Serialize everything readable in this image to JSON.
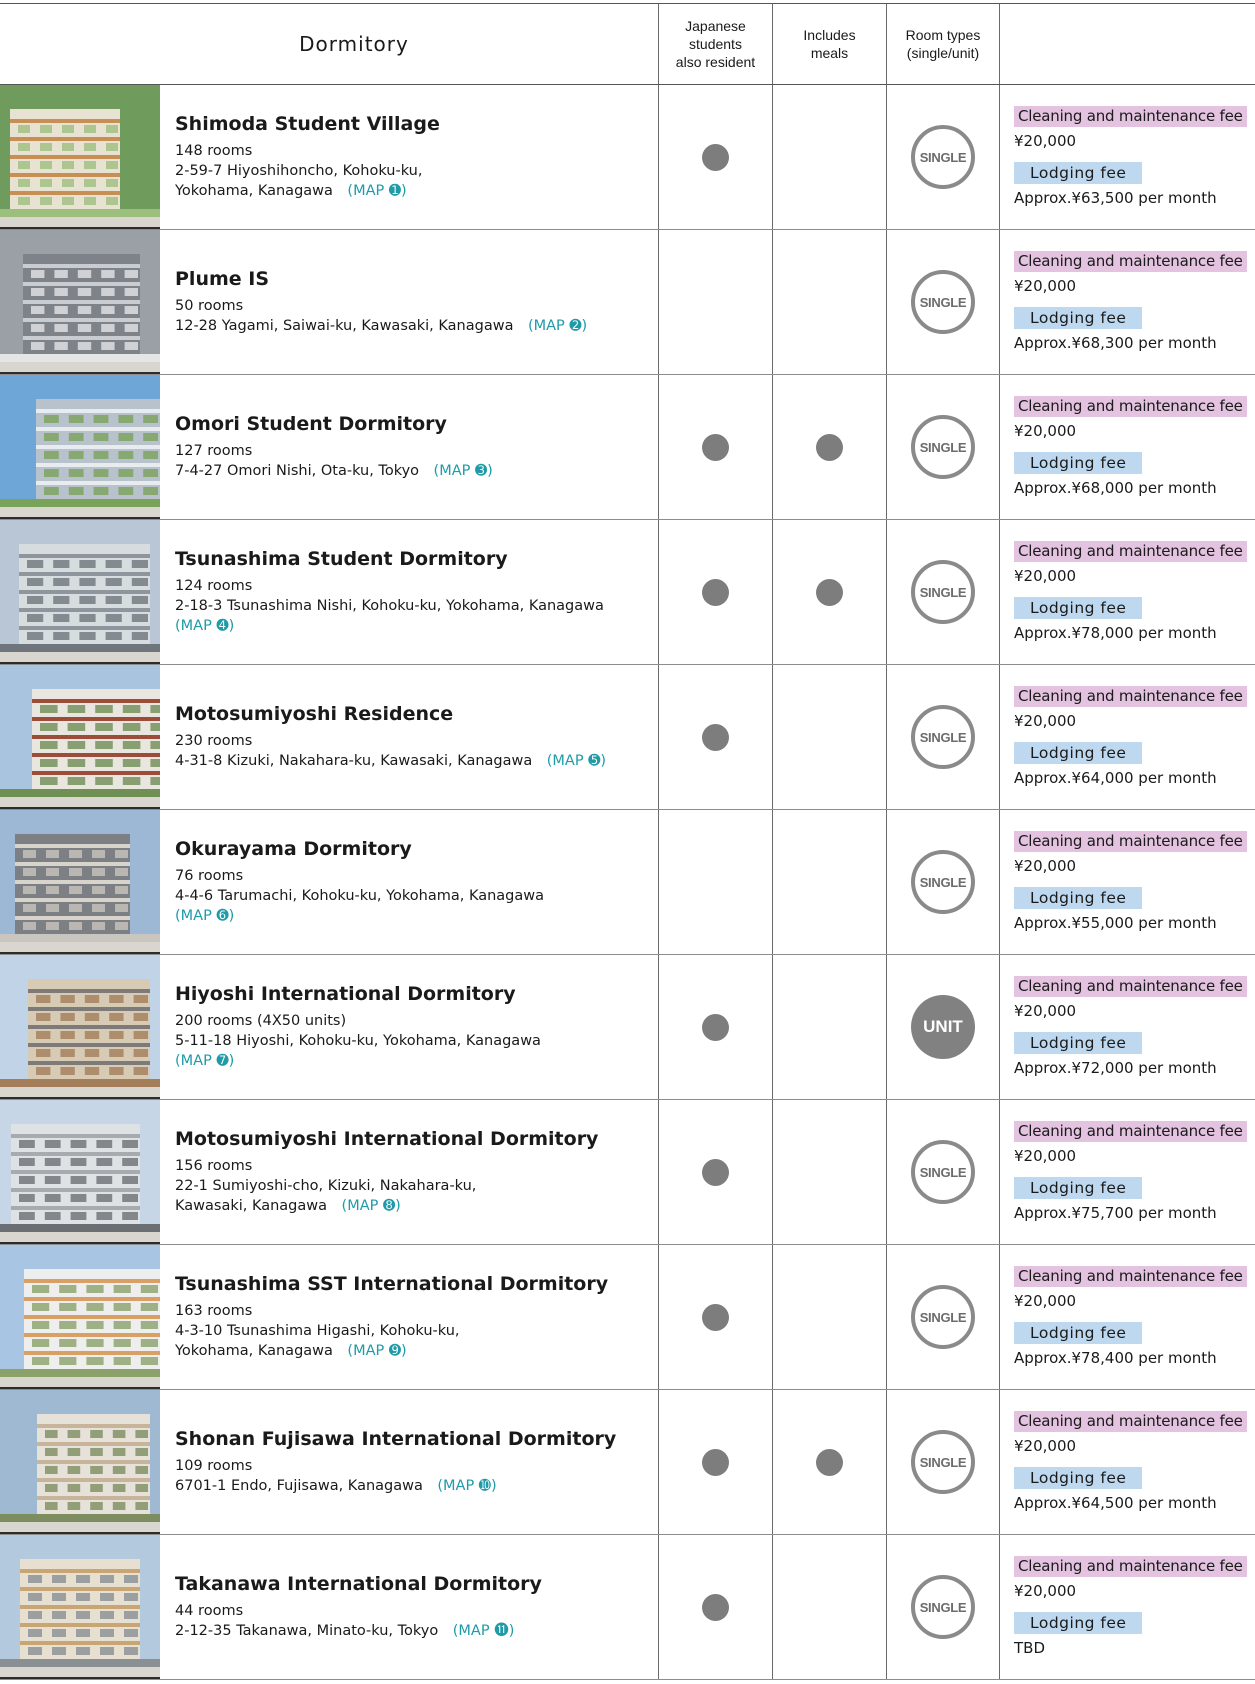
{
  "header": {
    "dormitory": "Dormitory",
    "japanese": "Japanese\nstudents\nalso resident",
    "meals": "Includes\nmeals",
    "room_types": "Room types\n(single/unit)"
  },
  "labels": {
    "cleaning_fee": "Cleaning and maintenance fee",
    "lodging_fee": "Lodging fee",
    "single": "SINGLE",
    "unit": "UNIT"
  },
  "colors": {
    "cleaning_tag": "#e3c3e0",
    "lodging_tag": "#bed8f0",
    "map_link": "#1f9ba8",
    "mark": "#7d7d7d"
  },
  "dorms": [
    {
      "name": "Shimoda Student Village",
      "rooms": "148 rooms",
      "address": "2-59-7 Hiyoshihoncho, Kohoku-ku,\nYokohama, Kanagawa　",
      "map": "(MAP ➊)",
      "japanese": true,
      "meals": false,
      "room_type": "single",
      "cleaning": "¥20,000",
      "lodging": "Approx.¥63,500 per month"
    },
    {
      "name": "Plume IS",
      "rooms": "50 rooms",
      "address": "12-28 Yagami, Saiwai-ku, Kawasaki, Kanagawa　",
      "map": "(MAP ➋)",
      "japanese": false,
      "meals": false,
      "room_type": "single",
      "cleaning": "¥20,000",
      "lodging": "Approx.¥68,300 per month"
    },
    {
      "name": "Omori Student Dormitory",
      "rooms": "127 rooms",
      "address": "7-4-27 Omori Nishi, Ota-ku, Tokyo　",
      "map": "(MAP ➌)",
      "japanese": true,
      "meals": true,
      "room_type": "single",
      "cleaning": "¥20,000",
      "lodging": "Approx.¥68,000 per month"
    },
    {
      "name": "Tsunashima Student Dormitory",
      "rooms": "124 rooms",
      "address": "2-18-3 Tsunashima Nishi, Kohoku-ku, Yokohama, Kanagawa\n",
      "map": "(MAP ➍)",
      "japanese": true,
      "meals": true,
      "room_type": "single",
      "cleaning": "¥20,000",
      "lodging": "Approx.¥78,000 per month"
    },
    {
      "name": "Motosumiyoshi Residence",
      "rooms": "230 rooms",
      "address": "4-31-8 Kizuki, Nakahara-ku, Kawasaki, Kanagawa　",
      "map": "(MAP ➎)",
      "japanese": true,
      "meals": false,
      "room_type": "single",
      "cleaning": "¥20,000",
      "lodging": "Approx.¥64,000 per month"
    },
    {
      "name": "Okurayama Dormitory",
      "rooms": "76 rooms",
      "address": "4-4-6 Tarumachi, Kohoku-ku, Yokohama, Kanagawa\n",
      "map": "(MAP ➏)",
      "japanese": false,
      "meals": false,
      "room_type": "single",
      "cleaning": "¥20,000",
      "lodging": "Approx.¥55,000 per month"
    },
    {
      "name": "Hiyoshi International Dormitory",
      "rooms": "200 rooms (4X50 units)",
      "address": "5-11-18 Hiyoshi, Kohoku-ku, Yokohama, Kanagawa\n",
      "map": "(MAP ➐)",
      "japanese": true,
      "meals": false,
      "room_type": "unit",
      "cleaning": "¥20,000",
      "lodging": "Approx.¥72,000 per month"
    },
    {
      "name": "Motosumiyoshi International Dormitory",
      "rooms": "156 rooms",
      "address": "22-1 Sumiyoshi-cho, Kizuki, Nakahara-ku,\nKawasaki, Kanagawa　",
      "map": "(MAP ➑)",
      "japanese": true,
      "meals": false,
      "room_type": "single",
      "cleaning": "¥20,000",
      "lodging": "Approx.¥75,700 per month"
    },
    {
      "name": "Tsunashima SST International Dormitory",
      "rooms": "163 rooms",
      "address": "4-3-10 Tsunashima Higashi, Kohoku-ku,\nYokohama, Kanagawa　",
      "map": "(MAP ➒)",
      "japanese": true,
      "meals": false,
      "room_type": "single",
      "cleaning": "¥20,000",
      "lodging": "Approx.¥78,400 per month"
    },
    {
      "name": "Shonan Fujisawa International Dormitory",
      "rooms": "109 rooms",
      "address": "6701-1 Endo, Fujisawa, Kanagawa　",
      "map": "(MAP ➓)",
      "japanese": true,
      "meals": true,
      "room_type": "single",
      "cleaning": "¥20,000",
      "lodging": "Approx.¥64,500 per month"
    },
    {
      "name": "Takanawa International Dormitory",
      "rooms": "44 rooms",
      "address": "2-12-35 Takanawa, Minato-ku, Tokyo　",
      "map": "(MAP ⓫)",
      "japanese": true,
      "meals": false,
      "room_type": "single",
      "cleaning": "¥20,000",
      "lodging": "TBD"
    }
  ]
}
